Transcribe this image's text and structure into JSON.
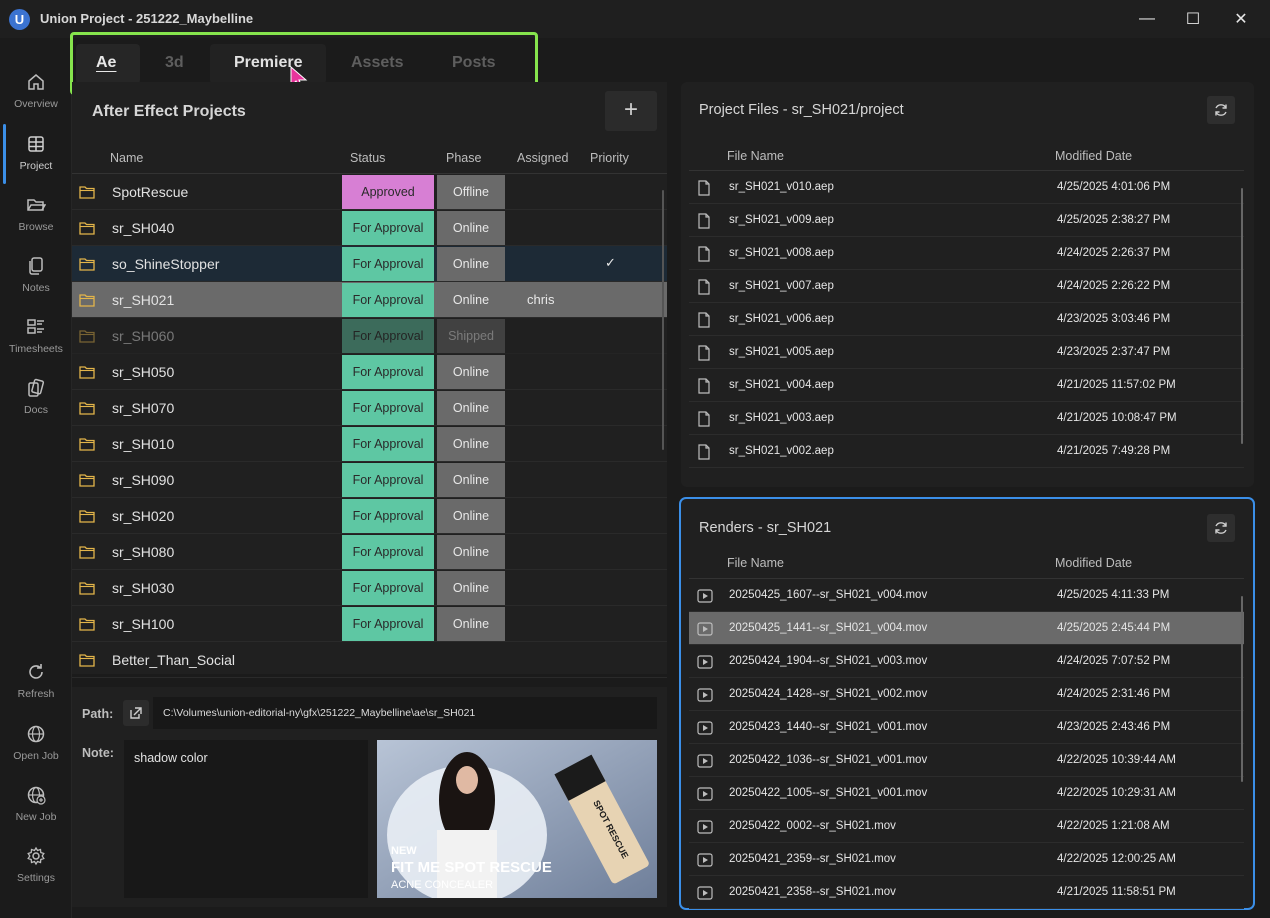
{
  "window": {
    "logo_letter": "U",
    "title": "Union Project - 251222_Maybelline",
    "minimize": "—",
    "maximize": "☐",
    "close": "✕"
  },
  "nav": [
    {
      "label": "Overview",
      "icon": "home-icon"
    },
    {
      "label": "Project",
      "icon": "grid-icon"
    },
    {
      "label": "Browse",
      "icon": "folder-open-icon"
    },
    {
      "label": "Notes",
      "icon": "notes-icon"
    },
    {
      "label": "Timesheets",
      "icon": "timesheet-icon"
    },
    {
      "label": "Docs",
      "icon": "docs-icon"
    },
    {
      "label": "Refresh",
      "icon": "refresh-icon"
    },
    {
      "label": "Open Job",
      "icon": "globe-icon"
    },
    {
      "label": "New Job",
      "icon": "globe-plus-icon"
    },
    {
      "label": "Settings",
      "icon": "gear-icon"
    }
  ],
  "tabs": [
    "Ae",
    "3d",
    "Premiere",
    "Assets",
    "Posts"
  ],
  "projects_panel": {
    "title": "After Effect Projects",
    "add_label": "+",
    "columns": {
      "name": "Name",
      "status": "Status",
      "phase": "Phase",
      "assigned": "Assigned",
      "priority": "Priority"
    },
    "rows": [
      {
        "name": "SpotRescue",
        "status": "Approved",
        "phase": "Offline",
        "assigned": "",
        "priority": ""
      },
      {
        "name": "sr_SH040",
        "status": "For Approval",
        "phase": "Online",
        "assigned": "",
        "priority": ""
      },
      {
        "name": "so_ShineStopper",
        "status": "For Approval",
        "phase": "Online",
        "assigned": "",
        "priority": "✓"
      },
      {
        "name": "sr_SH021",
        "status": "For Approval",
        "phase": "Online",
        "assigned": "chris",
        "priority": ""
      },
      {
        "name": "sr_SH060",
        "status": "For Approval",
        "phase": "Shipped",
        "assigned": "",
        "priority": ""
      },
      {
        "name": "sr_SH050",
        "status": "For Approval",
        "phase": "Online",
        "assigned": "",
        "priority": ""
      },
      {
        "name": "sr_SH070",
        "status": "For Approval",
        "phase": "Online",
        "assigned": "",
        "priority": ""
      },
      {
        "name": "sr_SH010",
        "status": "For Approval",
        "phase": "Online",
        "assigned": "",
        "priority": ""
      },
      {
        "name": "sr_SH090",
        "status": "For Approval",
        "phase": "Online",
        "assigned": "",
        "priority": ""
      },
      {
        "name": "sr_SH020",
        "status": "For Approval",
        "phase": "Online",
        "assigned": "",
        "priority": ""
      },
      {
        "name": "sr_SH080",
        "status": "For Approval",
        "phase": "Online",
        "assigned": "",
        "priority": ""
      },
      {
        "name": "sr_SH030",
        "status": "For Approval",
        "phase": "Online",
        "assigned": "",
        "priority": ""
      },
      {
        "name": "sr_SH100",
        "status": "For Approval",
        "phase": "Online",
        "assigned": "",
        "priority": ""
      },
      {
        "name": "Better_Than_Social",
        "status": "",
        "phase": "",
        "assigned": "",
        "priority": ""
      }
    ]
  },
  "info": {
    "path_label": "Path:",
    "path_value": "C:\\Volumes\\union-editorial-ny\\gfx\\251222_Maybelline\\ae\\sr_SH021",
    "note_label": "Note:",
    "note_value": "shadow color",
    "thumb_text_line1": "NEW",
    "thumb_text_line2": "FIT ME SPOT RESCUE",
    "thumb_text_line3": "ACNE CONCEALER",
    "thumb_product_text": "SPOT RESCUE"
  },
  "files_panel": {
    "title": "Project Files - sr_SH021/project",
    "col_name": "File Name",
    "col_date": "Modified Date",
    "rows": [
      {
        "name": "sr_SH021_v010.aep",
        "date": "4/25/2025 4:01:06 PM"
      },
      {
        "name": "sr_SH021_v009.aep",
        "date": "4/25/2025 2:38:27 PM"
      },
      {
        "name": "sr_SH021_v008.aep",
        "date": "4/24/2025 2:26:37 PM"
      },
      {
        "name": "sr_SH021_v007.aep",
        "date": "4/24/2025 2:26:22 PM"
      },
      {
        "name": "sr_SH021_v006.aep",
        "date": "4/23/2025 3:03:46 PM"
      },
      {
        "name": "sr_SH021_v005.aep",
        "date": "4/23/2025 2:37:47 PM"
      },
      {
        "name": "sr_SH021_v004.aep",
        "date": "4/21/2025 11:57:02 PM"
      },
      {
        "name": "sr_SH021_v003.aep",
        "date": "4/21/2025 10:08:47 PM"
      },
      {
        "name": "sr_SH021_v002.aep",
        "date": "4/21/2025 7:49:28 PM"
      }
    ]
  },
  "renders_panel": {
    "title": "Renders - sr_SH021",
    "col_name": "File Name",
    "col_date": "Modified Date",
    "rows": [
      {
        "name": "20250425_1607--sr_SH021_v004.mov",
        "date": "4/25/2025 4:11:33 PM"
      },
      {
        "name": "20250425_1441--sr_SH021_v004.mov",
        "date": "4/25/2025 2:45:44 PM"
      },
      {
        "name": "20250424_1904--sr_SH021_v003.mov",
        "date": "4/24/2025 7:07:52 PM"
      },
      {
        "name": "20250424_1428--sr_SH021_v002.mov",
        "date": "4/24/2025 2:31:46 PM"
      },
      {
        "name": "20250423_1440--sr_SH021_v001.mov",
        "date": "4/23/2025 2:43:46 PM"
      },
      {
        "name": "20250422_1036--sr_SH021_v001.mov",
        "date": "4/22/2025 10:39:44 AM"
      },
      {
        "name": "20250422_1005--sr_SH021_v001.mov",
        "date": "4/22/2025 10:29:31 AM"
      },
      {
        "name": "20250422_0002--sr_SH021.mov",
        "date": "4/22/2025 1:21:08 AM"
      },
      {
        "name": "20250421_2359--sr_SH021.mov",
        "date": "4/22/2025 12:00:25 AM"
      },
      {
        "name": "20250421_2358--sr_SH021.mov",
        "date": "4/21/2025 11:58:51 PM"
      }
    ]
  },
  "colors": {
    "approved": "#d77fd4",
    "for_approval": "#5ec7a3",
    "phase": "#6a6a6a",
    "accent": "#3b8fe8",
    "tab_highlight": "#86e44d"
  }
}
